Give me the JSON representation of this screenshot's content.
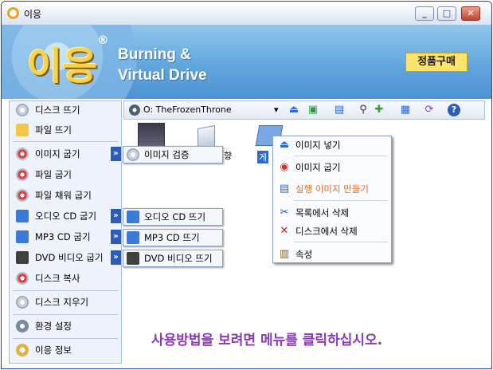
{
  "window": {
    "title": "이응",
    "min_label": "_",
    "max_label": "□",
    "close_label": "✕"
  },
  "banner": {
    "logo": "이응",
    "logo_mark": "®",
    "tagline_line1": "Burning &",
    "tagline_line2": "Virtual Drive",
    "buy_button": "정품구매"
  },
  "sidebar": {
    "items": [
      {
        "label": "디스크 뜨기",
        "icon": "disc-copy-icon"
      },
      {
        "label": "파일 뜨기",
        "icon": "file-copy-icon"
      },
      {
        "label": "이미지 굽기",
        "icon": "image-burn-icon"
      },
      {
        "label": "파일 굽기",
        "icon": "file-burn-icon"
      },
      {
        "label": "파일 채워 굽기",
        "icon": "file-fill-burn-icon"
      },
      {
        "label": "오디오 CD 굽기",
        "icon": "audio-cd-icon"
      },
      {
        "label": "MP3 CD 굽기",
        "icon": "mp3-cd-icon"
      },
      {
        "label": "DVD 비디오 굽기",
        "icon": "dvd-video-icon"
      },
      {
        "label": "디스크 복사",
        "icon": "disc-duplicate-icon"
      },
      {
        "label": "디스크 지우기",
        "icon": "disc-erase-icon"
      },
      {
        "label": "환경 설정",
        "icon": "settings-icon"
      },
      {
        "label": "이응 정보",
        "icon": "info-icon"
      }
    ],
    "arrow_label": "»",
    "submenus": {
      "image_verify": "이미지 검증",
      "audio_cd_copy": "오디오 CD 뜨기",
      "mp3_cd_copy": "MP3 CD 뜨기",
      "dvd_video_copy": "DVD 비디오 뜨기"
    }
  },
  "toolbar": {
    "drive": "O: TheFrozenThrone",
    "drive_dropdown": "▾"
  },
  "files": [
    {
      "label": ""
    },
    {
      "label": "향"
    },
    {
      "label": "게"
    }
  ],
  "context_menu": {
    "items": [
      "이미지 넣기",
      "이미지 굽기",
      "실행 이미지 만들기",
      "목록에서 삭제",
      "디스크에서 삭제",
      "속성"
    ],
    "highlight_color": "#e07020"
  },
  "hint": "사용방법을 보려면 메뉴를 클릭하십시오."
}
